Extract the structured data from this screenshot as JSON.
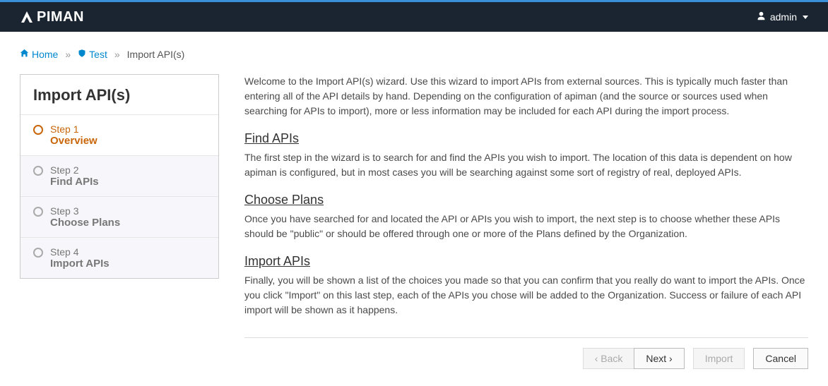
{
  "navbar": {
    "logo_text": "PIMAN",
    "user_label": "admin"
  },
  "breadcrumb": {
    "home": "Home",
    "org": "Test",
    "current": "Import API(s)"
  },
  "sidebar": {
    "title": "Import API(s)",
    "steps": [
      {
        "num": "Step 1",
        "label": "Overview"
      },
      {
        "num": "Step 2",
        "label": "Find APIs"
      },
      {
        "num": "Step 3",
        "label": "Choose Plans"
      },
      {
        "num": "Step 4",
        "label": "Import APIs"
      }
    ]
  },
  "content": {
    "intro": "Welcome to the Import API(s) wizard. Use this wizard to import APIs from external sources. This is typically much faster than entering all of the API details by hand. Depending on the configuration of apiman (and the source or sources used when searching for APIs to import), more or less information may be included for each API during the import process.",
    "sections": [
      {
        "heading": "Find APIs",
        "body": "The first step in the wizard is to search for and find the APIs you wish to import. The location of this data is dependent on how apiman is configured, but in most cases you will be searching against some sort of registry of real, deployed APIs."
      },
      {
        "heading": "Choose Plans",
        "body": "Once you have searched for and located the API or APIs you wish to import, the next step is to choose whether these APIs should be \"public\" or should be offered through one or more of the Plans defined by the Organization."
      },
      {
        "heading": "Import APIs",
        "body": "Finally, you will be shown a list of the choices you made so that you can confirm that you really do want to import the APIs. Once you click \"Import\" on this last step, each of the APIs you chose will be added to the Organization. Success or failure of each API import will be shown as it happens."
      }
    ]
  },
  "actions": {
    "back": "‹ Back",
    "next": "Next ›",
    "import": "Import",
    "cancel": "Cancel"
  }
}
